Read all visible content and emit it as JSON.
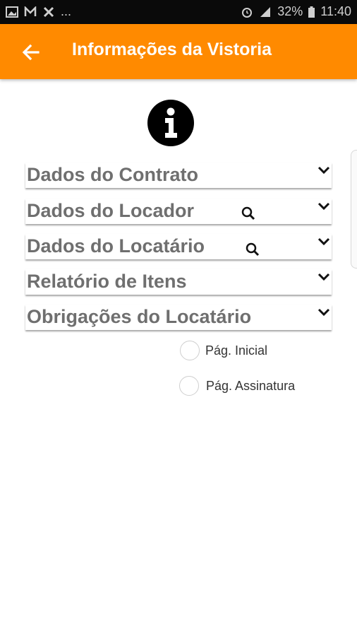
{
  "status_bar": {
    "left_icons": [
      "gallery-icon",
      "mail-icon",
      "close-icon"
    ],
    "ellipsis": "...",
    "battery": "32%",
    "time": "11:40"
  },
  "header": {
    "title": "Informações da Vistoria",
    "back_icon": "arrow-left-icon",
    "color": "#ff8a00"
  },
  "info_icon": "info-icon",
  "sections": [
    {
      "label": "Dados do Contrato",
      "has_search": false
    },
    {
      "label": "Dados do Locador",
      "has_search": true
    },
    {
      "label": "Dados do Locatário",
      "has_search": true
    },
    {
      "label": "Relatório de Itens",
      "has_search": false
    },
    {
      "label": "Obrigações do Locatário",
      "has_search": false
    }
  ],
  "options": [
    {
      "label": "Pág. Inicial",
      "selected": false
    },
    {
      "label": "Pág. Assinatura",
      "selected": false
    }
  ]
}
